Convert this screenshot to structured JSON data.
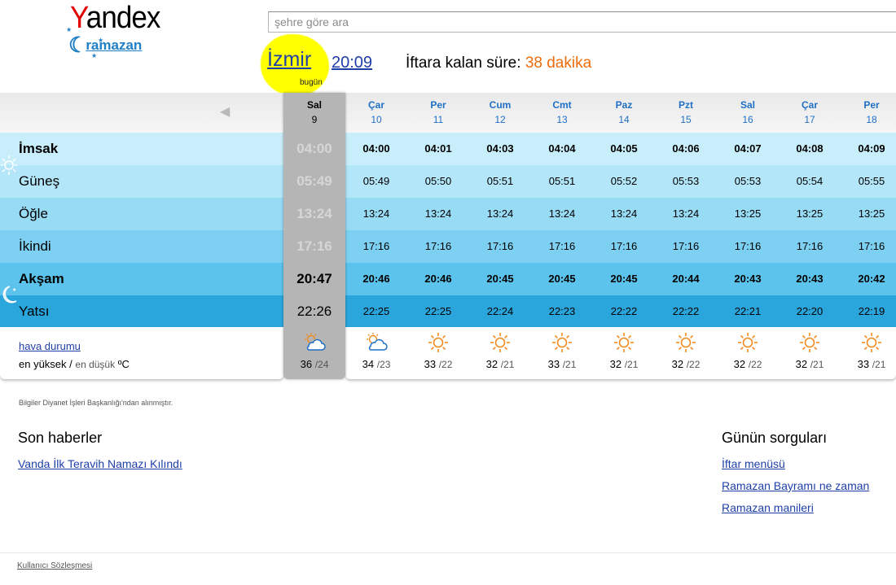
{
  "logo": {
    "brand": "Yandex",
    "sub": "ramazan"
  },
  "search": {
    "placeholder": "şehre göre ara"
  },
  "header": {
    "city": "İzmir",
    "time": "20:09",
    "today_label": "bugün",
    "iftar_label": "İftara kalan süre:",
    "iftar_remaining": "38 dakika"
  },
  "days": [
    {
      "name": "Sal",
      "num": "9",
      "today": true
    },
    {
      "name": "Çar",
      "num": "10"
    },
    {
      "name": "Per",
      "num": "11"
    },
    {
      "name": "Cum",
      "num": "12"
    },
    {
      "name": "Cmt",
      "num": "13"
    },
    {
      "name": "Paz",
      "num": "14"
    },
    {
      "name": "Pzt",
      "num": "15"
    },
    {
      "name": "Sal",
      "num": "16"
    },
    {
      "name": "Çar",
      "num": "17"
    },
    {
      "name": "Per",
      "num": "18"
    }
  ],
  "prayers": [
    {
      "name": "İmsak",
      "bold": true,
      "bg": "#c9eefb",
      "times": [
        "04:00",
        "04:00",
        "04:01",
        "04:03",
        "04:04",
        "04:05",
        "04:06",
        "04:07",
        "04:08",
        "04:09"
      ]
    },
    {
      "name": "Güneş",
      "bold": false,
      "bg": "#b2e6f8",
      "times": [
        "05:49",
        "05:49",
        "05:50",
        "05:51",
        "05:51",
        "05:52",
        "05:53",
        "05:53",
        "05:54",
        "05:55"
      ]
    },
    {
      "name": "Öğle",
      "bold": false,
      "bg": "#97dbf5",
      "times": [
        "13:24",
        "13:24",
        "13:24",
        "13:24",
        "13:24",
        "13:24",
        "13:24",
        "13:25",
        "13:25",
        "13:25"
      ]
    },
    {
      "name": "İkindi",
      "bold": false,
      "bg": "#7dd0f1",
      "times": [
        "17:16",
        "17:16",
        "17:16",
        "17:16",
        "17:16",
        "17:16",
        "17:16",
        "17:16",
        "17:16",
        "17:16"
      ]
    },
    {
      "name": "Akşam",
      "bold": true,
      "bg": "#5bc3ec",
      "times": [
        "20:47",
        "20:46",
        "20:46",
        "20:45",
        "20:45",
        "20:45",
        "20:44",
        "20:43",
        "20:43",
        "20:42"
      ]
    },
    {
      "name": "Yatsı",
      "bold": false,
      "bg": "#2aa6dd",
      "times": [
        "22:26",
        "22:25",
        "22:25",
        "22:24",
        "22:23",
        "22:22",
        "22:22",
        "22:21",
        "22:20",
        "22:19"
      ]
    }
  ],
  "weather": {
    "link": "hava durumu",
    "label_high": "en yüksek /",
    "label_low": "en düşük",
    "unit": "ºC",
    "days": [
      {
        "icon": "partly-cloudy-icon",
        "high": "36",
        "low": "24"
      },
      {
        "icon": "partly-cloudy-icon",
        "high": "34",
        "low": "23"
      },
      {
        "icon": "sun-icon",
        "high": "33",
        "low": "22"
      },
      {
        "icon": "sun-icon",
        "high": "32",
        "low": "21"
      },
      {
        "icon": "sun-icon",
        "high": "33",
        "low": "21"
      },
      {
        "icon": "sun-icon",
        "high": "32",
        "low": "21"
      },
      {
        "icon": "sun-icon",
        "high": "32",
        "low": "22"
      },
      {
        "icon": "sun-icon",
        "high": "32",
        "low": "22"
      },
      {
        "icon": "sun-icon",
        "high": "32",
        "low": "21"
      },
      {
        "icon": "sun-icon",
        "high": "33",
        "low": "21"
      }
    ]
  },
  "source": "Bilgiler Diyanet İşleri Başkanlığı'ndan alınmıştır.",
  "news": {
    "title": "Son haberler",
    "items": [
      "Vanda İlk Teravih Namazı Kılındı"
    ]
  },
  "queries": {
    "title": "Günün sorguları",
    "items": [
      "İftar menüsü",
      "Ramazan Bayramı ne zaman",
      "Ramazan manileri"
    ]
  },
  "footer": {
    "terms": "Kullanıcı Sözleşmesi"
  },
  "colors": {
    "link": "#1f3fa8",
    "accent": "#ef6c0b",
    "highlight": "#ffff00"
  }
}
